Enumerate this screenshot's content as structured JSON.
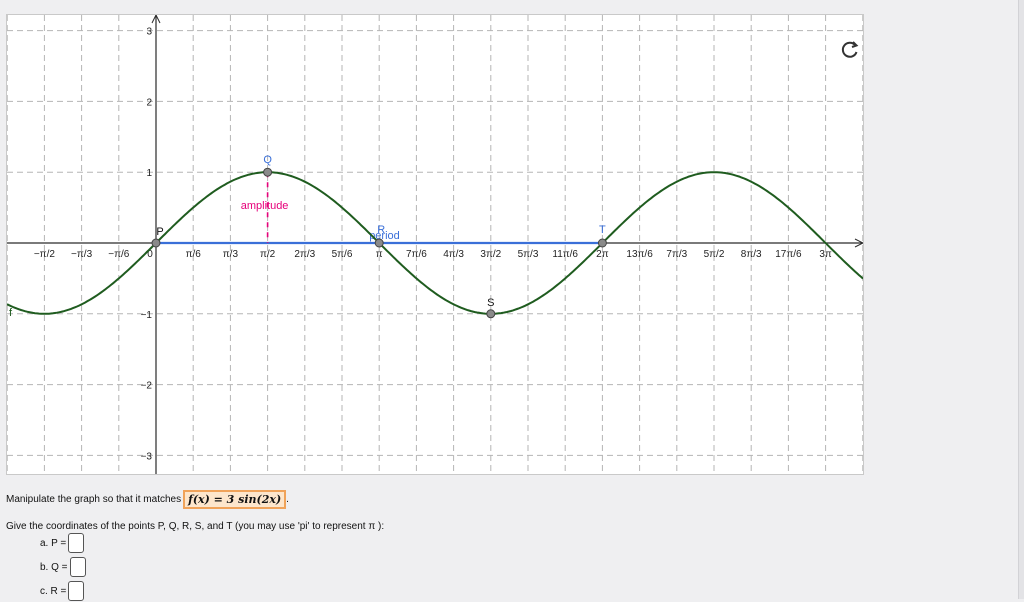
{
  "graph": {
    "x_tick_labels": [
      "−π/2",
      "−π/3",
      "−π/6",
      "0",
      "π/6",
      "π/3",
      "π/2",
      "2π/3",
      "5π/6",
      "π",
      "7π/6",
      "4π/3",
      "3π/2",
      "5π/3",
      "11π/6",
      "2π",
      "13π/6",
      "7π/3",
      "5π/2",
      "8π/3",
      "17π/6",
      "3π"
    ],
    "y_tick_labels": [
      "3",
      "2",
      "1",
      "−1",
      "−2",
      "−3"
    ],
    "function_label": "f",
    "amplitude_label": "amplitude",
    "period_label": "period",
    "points": {
      "P": "P",
      "Q": "Q",
      "R": "R",
      "S": "S",
      "T": "T"
    },
    "colors": {
      "curve": "#1f5c1f",
      "period_segment": "#3a6fd8",
      "amplitude_segment": "#e6007a",
      "point_label_Q": "#3a6fd8",
      "point_label_R": "#3a6fd8",
      "point_label_T": "#3a6fd8",
      "point_label_P": "#111111",
      "point_label_S": "#111111"
    },
    "refresh_icon": "refresh-icon"
  },
  "instructions": {
    "prefix": "Manipulate the graph so that it matches",
    "target_function": "f(x) = 3 sin(2x)",
    "suffix": "."
  },
  "question": {
    "text": "Give the coordinates of the points P, Q, R, S, and T (you may use 'pi' to represent π ):"
  },
  "answers": [
    {
      "label": "a.  P ="
    },
    {
      "label": "b.  Q ="
    },
    {
      "label": "c.  R ="
    }
  ]
}
